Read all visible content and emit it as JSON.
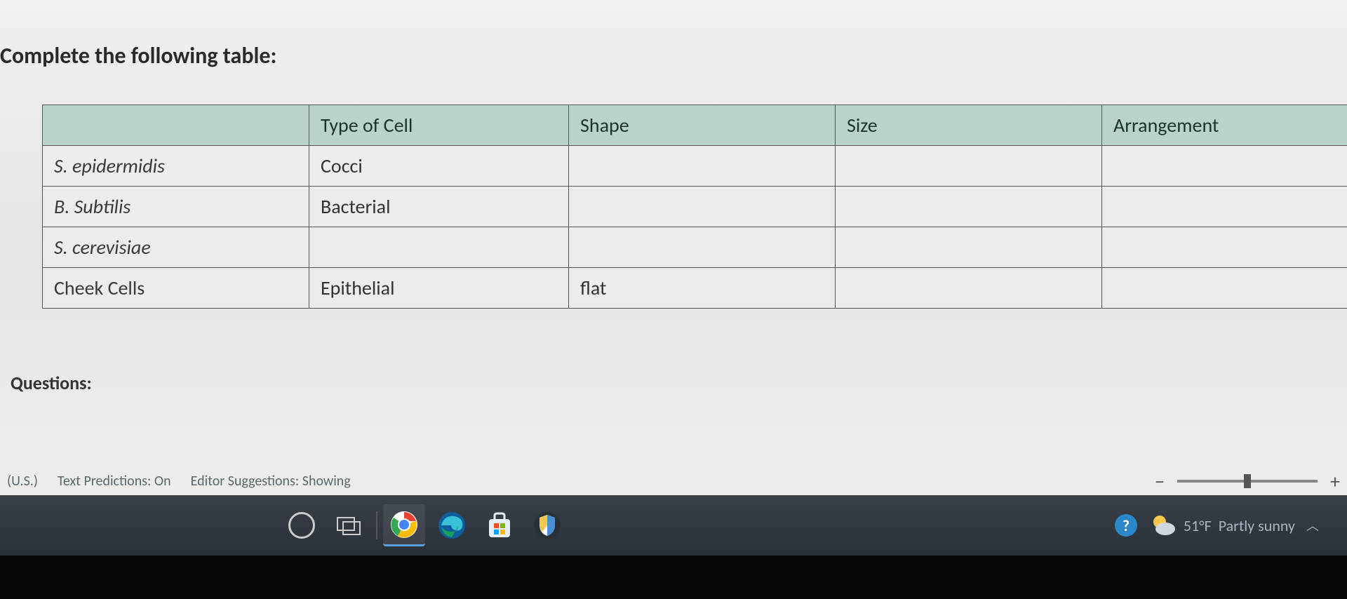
{
  "document": {
    "title": "Complete the following table:",
    "table": {
      "headers": [
        "",
        "Type of Cell",
        "Shape",
        "Size",
        "Arrangement"
      ],
      "rows": [
        {
          "label": "S. epidermidis",
          "type_of_cell": "Cocci",
          "shape": "",
          "size": "",
          "arrangement": ""
        },
        {
          "label": "B. Subtilis",
          "type_of_cell": "Bacterial",
          "shape": "",
          "size": "",
          "arrangement": ""
        },
        {
          "label": "S. cerevisiae",
          "type_of_cell": "",
          "shape": "",
          "size": "",
          "arrangement": ""
        },
        {
          "label": "Cheek Cells",
          "type_of_cell": "Epithelial",
          "shape": "flat",
          "size": "",
          "arrangement": ""
        }
      ]
    },
    "questions_label": "Questions:"
  },
  "status_bar": {
    "language": "(U.S.)",
    "text_predictions": "Text Predictions: On",
    "editor_suggestions": "Editor Suggestions: Showing",
    "zoom_minus": "−",
    "zoom_plus": "+"
  },
  "taskbar": {
    "weather_temp": "51°F",
    "weather_desc": "Partly sunny"
  }
}
